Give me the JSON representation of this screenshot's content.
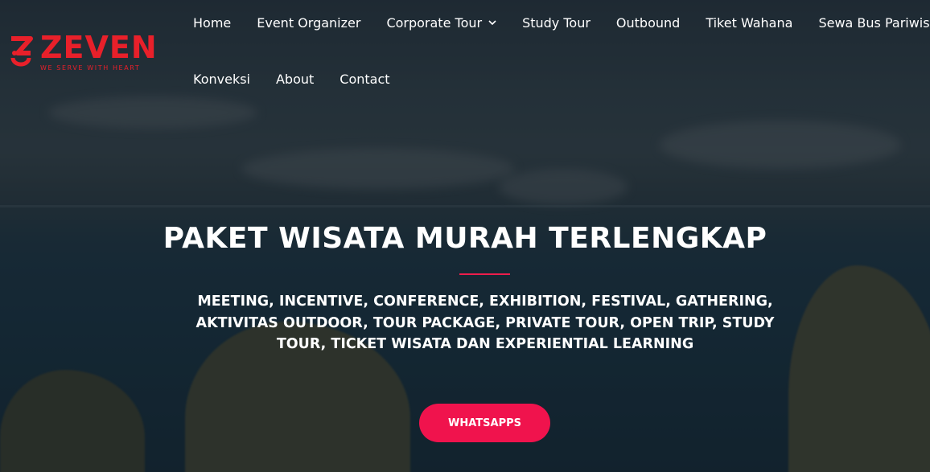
{
  "brand": {
    "name": "ZEVEN",
    "tagline": "WE SERVE WITH HEART",
    "color": "#e8202a"
  },
  "nav": {
    "items": [
      {
        "label": "Home"
      },
      {
        "label": "Event Organizer"
      },
      {
        "label": "Corporate Tour",
        "has_dropdown": true
      },
      {
        "label": "Study Tour"
      },
      {
        "label": "Outbound"
      },
      {
        "label": "Tiket Wahana"
      },
      {
        "label": "Sewa Bus Pariwisata"
      },
      {
        "label": "Konveksi"
      },
      {
        "label": "About"
      },
      {
        "label": "Contact"
      }
    ]
  },
  "hero": {
    "title": "PAKET WISATA MURAH TERLENGKAP",
    "subtitle": "MEETING, INCENTIVE, CONFERENCE, EXHIBITION, FESTIVAL, GATHERING, AKTIVITAS OUTDOOR, TOUR PACKAGE, PRIVATE TOUR, OPEN TRIP, STUDY TOUR, TICKET WISATA DAN EXPERIENTIAL LEARNING",
    "cta_label": "WHATSAPPS",
    "accent": "#f0134d"
  },
  "icons": {
    "logo": "zeven-logo-mark",
    "dropdown": "chevron-down-icon"
  }
}
